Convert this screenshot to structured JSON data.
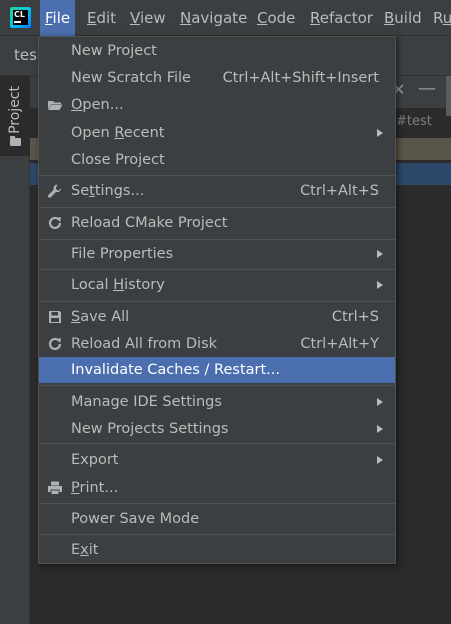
{
  "app": {
    "logo_text": "CL"
  },
  "menubar": {
    "items": [
      {
        "pre": "",
        "mn": "F",
        "post": "ile"
      },
      {
        "pre": "",
        "mn": "E",
        "post": "dit"
      },
      {
        "pre": "",
        "mn": "V",
        "post": "iew"
      },
      {
        "pre": "",
        "mn": "N",
        "post": "avigate"
      },
      {
        "pre": "",
        "mn": "C",
        "post": "ode"
      },
      {
        "pre": "",
        "mn": "R",
        "post": "efactor"
      },
      {
        "pre": "",
        "mn": "B",
        "post": "uild"
      },
      {
        "pre": "R",
        "mn": "u",
        "post": ""
      }
    ]
  },
  "toolbar": {
    "project_crumb": "tes"
  },
  "tool_strip": {
    "project_label": "Project"
  },
  "background": {
    "close_glyph": "✕",
    "minimize_glyph": "—",
    "hash_text": "#test"
  },
  "file_menu": {
    "items": [
      {
        "pre": "New Project",
        "mn": "",
        "post": "",
        "shortcut": ""
      },
      {
        "pre": "New Scratch File",
        "mn": "",
        "post": "",
        "shortcut": "Ctrl+Alt+Shift+Insert"
      },
      {
        "pre": "",
        "mn": "O",
        "post": "pen...",
        "shortcut": ""
      },
      {
        "pre": "Open ",
        "mn": "R",
        "post": "ecent",
        "shortcut": ""
      },
      {
        "pre": "Close Project",
        "mn": "",
        "post": "",
        "shortcut": ""
      },
      {
        "pre": "Se",
        "mn": "t",
        "post": "tings...",
        "shortcut": "Ctrl+Alt+S"
      },
      {
        "pre": "Reload CMake Project",
        "mn": "",
        "post": "",
        "shortcut": ""
      },
      {
        "pre": "File Properties",
        "mn": "",
        "post": "",
        "shortcut": ""
      },
      {
        "pre": "Local ",
        "mn": "H",
        "post": "istory",
        "shortcut": ""
      },
      {
        "pre": "",
        "mn": "S",
        "post": "ave All",
        "shortcut": "Ctrl+S"
      },
      {
        "pre": "Reload All from Disk",
        "mn": "",
        "post": "",
        "shortcut": "Ctrl+Alt+Y"
      },
      {
        "pre": "Invalidate Caches / Restart...",
        "mn": "",
        "post": "",
        "shortcut": ""
      },
      {
        "pre": "Manage IDE Settings",
        "mn": "",
        "post": "",
        "shortcut": ""
      },
      {
        "pre": "New Projects Settings",
        "mn": "",
        "post": "",
        "shortcut": ""
      },
      {
        "pre": "Export",
        "mn": "",
        "post": "",
        "shortcut": ""
      },
      {
        "pre": "",
        "mn": "P",
        "post": "rint...",
        "shortcut": ""
      },
      {
        "pre": "Power Save Mode",
        "mn": "",
        "post": "",
        "shortcut": ""
      },
      {
        "pre": "E",
        "mn": "x",
        "post": "it",
        "shortcut": ""
      }
    ]
  },
  "colors": {
    "menubar_bg": "#3c3f41",
    "selection": "#4b6eaf",
    "text": "#bbbbbb",
    "separator": "#515151"
  }
}
